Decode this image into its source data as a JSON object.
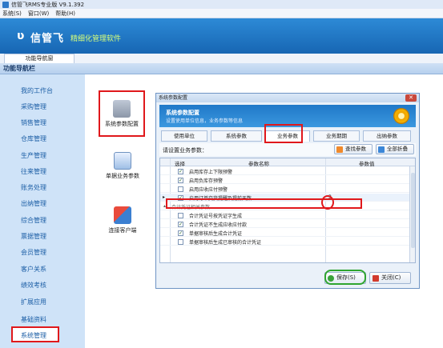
{
  "window": {
    "title": "信管飞RMS专业版 V9.1.392"
  },
  "menubar": {
    "items": [
      "系统(S)",
      "窗口(W)",
      "帮助(H)"
    ]
  },
  "banner": {
    "brand": "信管飞",
    "slogan": "精细化管理软件"
  },
  "nav": {
    "tab": "功能导航窗",
    "header": "功能导航栏",
    "items": [
      "我的工作台",
      "采购管理",
      "销售管理",
      "仓库管理",
      "生产管理",
      "往来管理",
      "账务处理",
      "出纳管理",
      "综合管理",
      "票据管理",
      "会员管理",
      "客户关系",
      "绩效考核",
      "扩展应用",
      "基础资料",
      "系统管理"
    ]
  },
  "tiles": [
    {
      "label": "系统参数配置"
    },
    {
      "label": "单据业务参数"
    },
    {
      "label": "连接客户端"
    }
  ],
  "dialog": {
    "title": "系统参数配置",
    "header_title": "系统参数配置",
    "header_subtitle": "设置使用单位信息，业务参数等信息",
    "tabs": [
      "使用单位",
      "系统参数",
      "业务参数",
      "业务期期",
      "出纳参数"
    ],
    "active_tab": "业务参数",
    "toolbar_label": "请设置业务参数：",
    "find_button": "查找参数",
    "collapse_button": "全部折叠",
    "columns": [
      "选择",
      "参数名称",
      "参数值"
    ],
    "rows": [
      {
        "checked": true,
        "name": "启用库存上下限预警",
        "value": ""
      },
      {
        "checked": true,
        "name": "启用负库存预警",
        "value": ""
      },
      {
        "checked": false,
        "name": "启用应收应付预警",
        "value": ""
      },
      {
        "checked": true,
        "name": "启用订单交货提醒及提前天数",
        "value": "3"
      }
    ],
    "group": "合计凭证相关参数",
    "group_rows": [
      {
        "checked": false,
        "name": "合计凭证号按凭证字生成",
        "value": ""
      },
      {
        "checked": true,
        "name": "合计凭证不生成应收应付款",
        "value": ""
      },
      {
        "checked": true,
        "name": "单据审核后生成合计凭证",
        "value": ""
      },
      {
        "checked": false,
        "name": "单据审核后生成已审核的合计凭证",
        "value": ""
      }
    ],
    "save_button": "保存(S)",
    "close_button": "关闭(C)"
  },
  "colors": {
    "accent": "#1766b3",
    "highlight": "#e0181b",
    "save_highlight": "#2fa52f"
  }
}
